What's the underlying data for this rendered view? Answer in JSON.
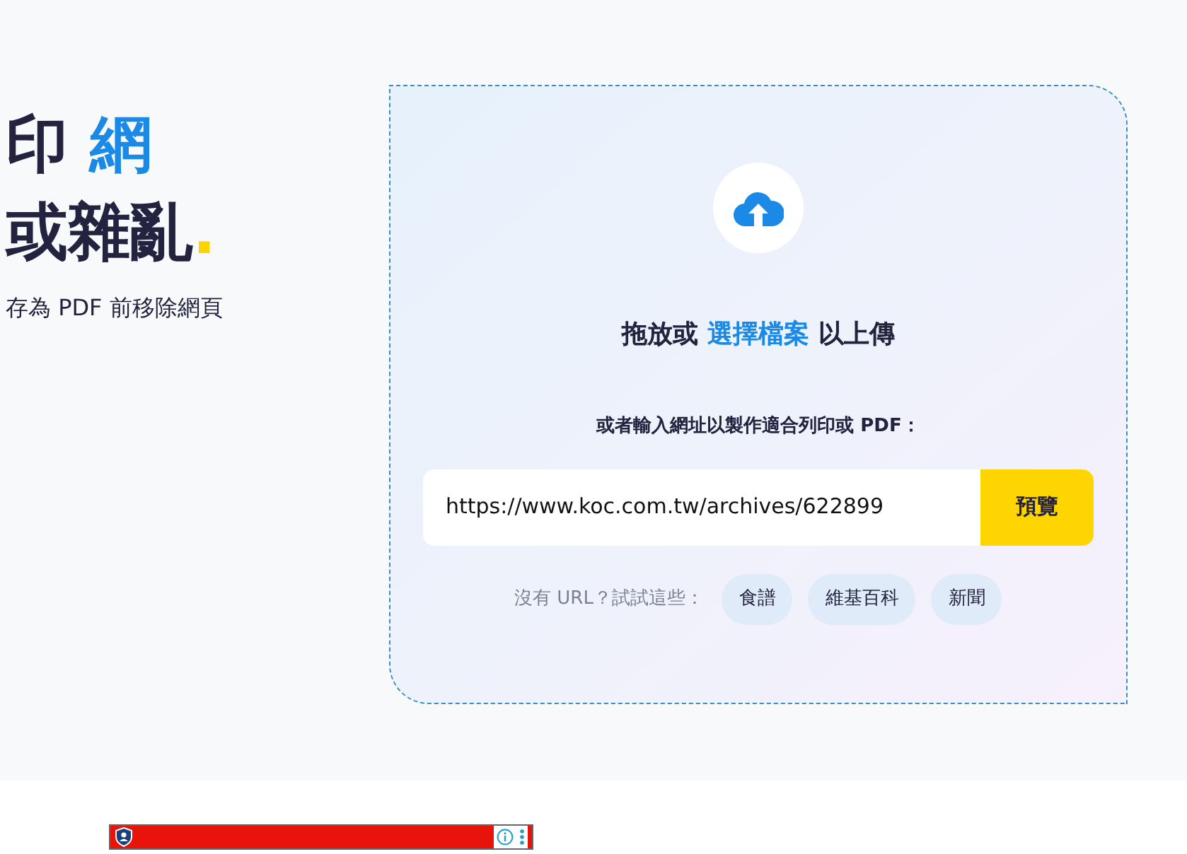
{
  "hero": {
    "line1": "印",
    "line1_highlight": "網",
    "line2": "或雜亂",
    "line2_mark": ".",
    "subtitle": "存為 PDF 前移除網頁"
  },
  "upload": {
    "prompt_before": "拖放或",
    "prompt_link": "選擇檔案",
    "prompt_after": "以上傳",
    "url_label": "或者輸入網址以製作適合列印或 PDF：",
    "url_value": "https://www.koc.com.tw/archives/622899",
    "preview_button": "預覽",
    "suggestion_label": "沒有 URL？試試這些：",
    "suggestions": [
      "食譜",
      "維基百科",
      "新聞"
    ]
  }
}
